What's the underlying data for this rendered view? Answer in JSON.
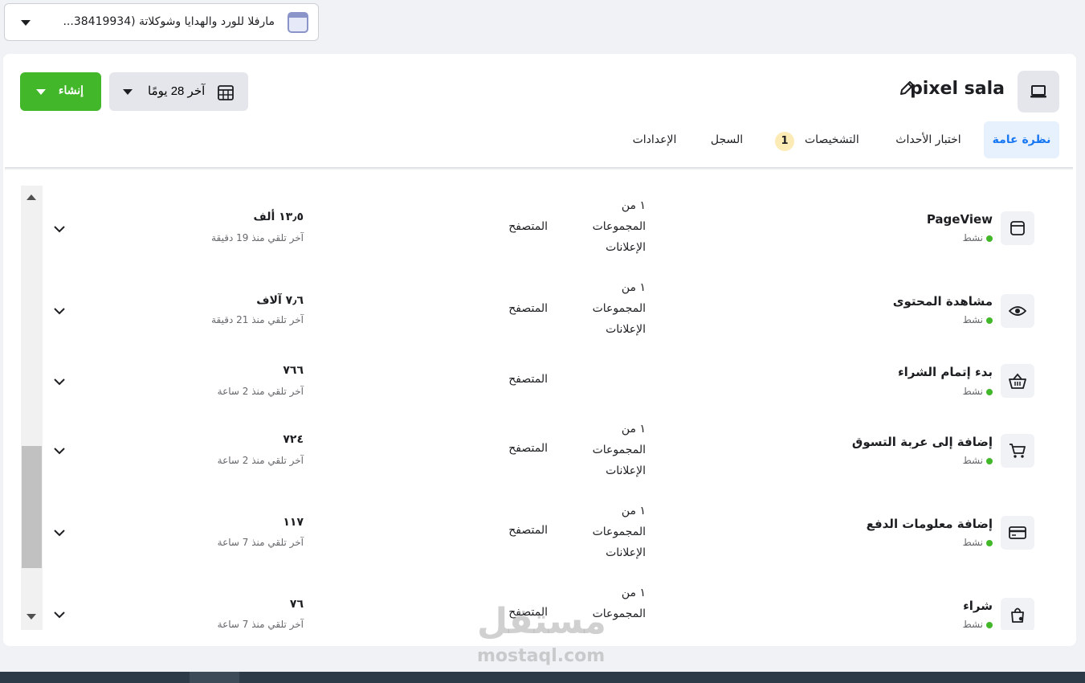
{
  "account": {
    "name": "مارفلا للورد والهدايا وشوكلاتة (38419934..."
  },
  "header": {
    "title": "pixel sala",
    "create_label": "إنشاء",
    "date_range_label": "آخر 28 يومًا"
  },
  "tabs": [
    {
      "label": "نظرة عامة",
      "active": true
    },
    {
      "label": "اختبار الأحداث",
      "active": false
    },
    {
      "label": "التشخيصات",
      "active": false,
      "badge": "1"
    },
    {
      "label": "السجل",
      "active": false
    },
    {
      "label": "الإعدادات",
      "active": false
    }
  ],
  "events": [
    {
      "name": "PageView",
      "status": "نشط",
      "groups": "١ من المجموعات الإعلانات",
      "source": "المتصفح",
      "count": "١٣٫٥ ألف",
      "last_received": "آخر تلقي منذ 19 دقيقة",
      "icon": "browser-window-icon"
    },
    {
      "name": "مشاهدة المحتوى",
      "status": "نشط",
      "groups": "١ من المجموعات الإعلانات",
      "source": "المتصفح",
      "count": "٧٫٦ آلاف",
      "last_received": "آخر تلقي منذ 21 دقيقة",
      "icon": "eye-icon"
    },
    {
      "name": "بدء إتمام الشراء",
      "status": "نشط",
      "groups": "",
      "source": "المتصفح",
      "count": "٧٦٦",
      "last_received": "آخر تلقي منذ 2 ساعة",
      "icon": "basket-icon"
    },
    {
      "name": "إضافة إلى عربة التسوق",
      "status": "نشط",
      "groups": "١ من المجموعات الإعلانات",
      "source": "المتصفح",
      "count": "٧٢٤",
      "last_received": "آخر تلقي منذ 2 ساعة",
      "icon": "cart-icon"
    },
    {
      "name": "إضافة معلومات الدفع",
      "status": "نشط",
      "groups": "١ من المجموعات الإعلانات",
      "source": "المتصفح",
      "count": "١١٧",
      "last_received": "آخر تلقي منذ 7 ساعة",
      "icon": "credit-card-icon"
    },
    {
      "name": "شراء",
      "status": "نشط",
      "groups": "١ من المجموعات",
      "source": "المتصفح",
      "count": "٧٦",
      "last_received": "آخر تلقي منذ 7 ساعة",
      "icon": "shopping-bag-icon"
    }
  ],
  "watermark": {
    "arabic": "مستقل",
    "latin": "mostaql.com"
  },
  "colors": {
    "accent": "#1877f2",
    "create_green": "#42b72a",
    "active_dot": "#42b72a",
    "badge_bg": "#fdebb5"
  }
}
